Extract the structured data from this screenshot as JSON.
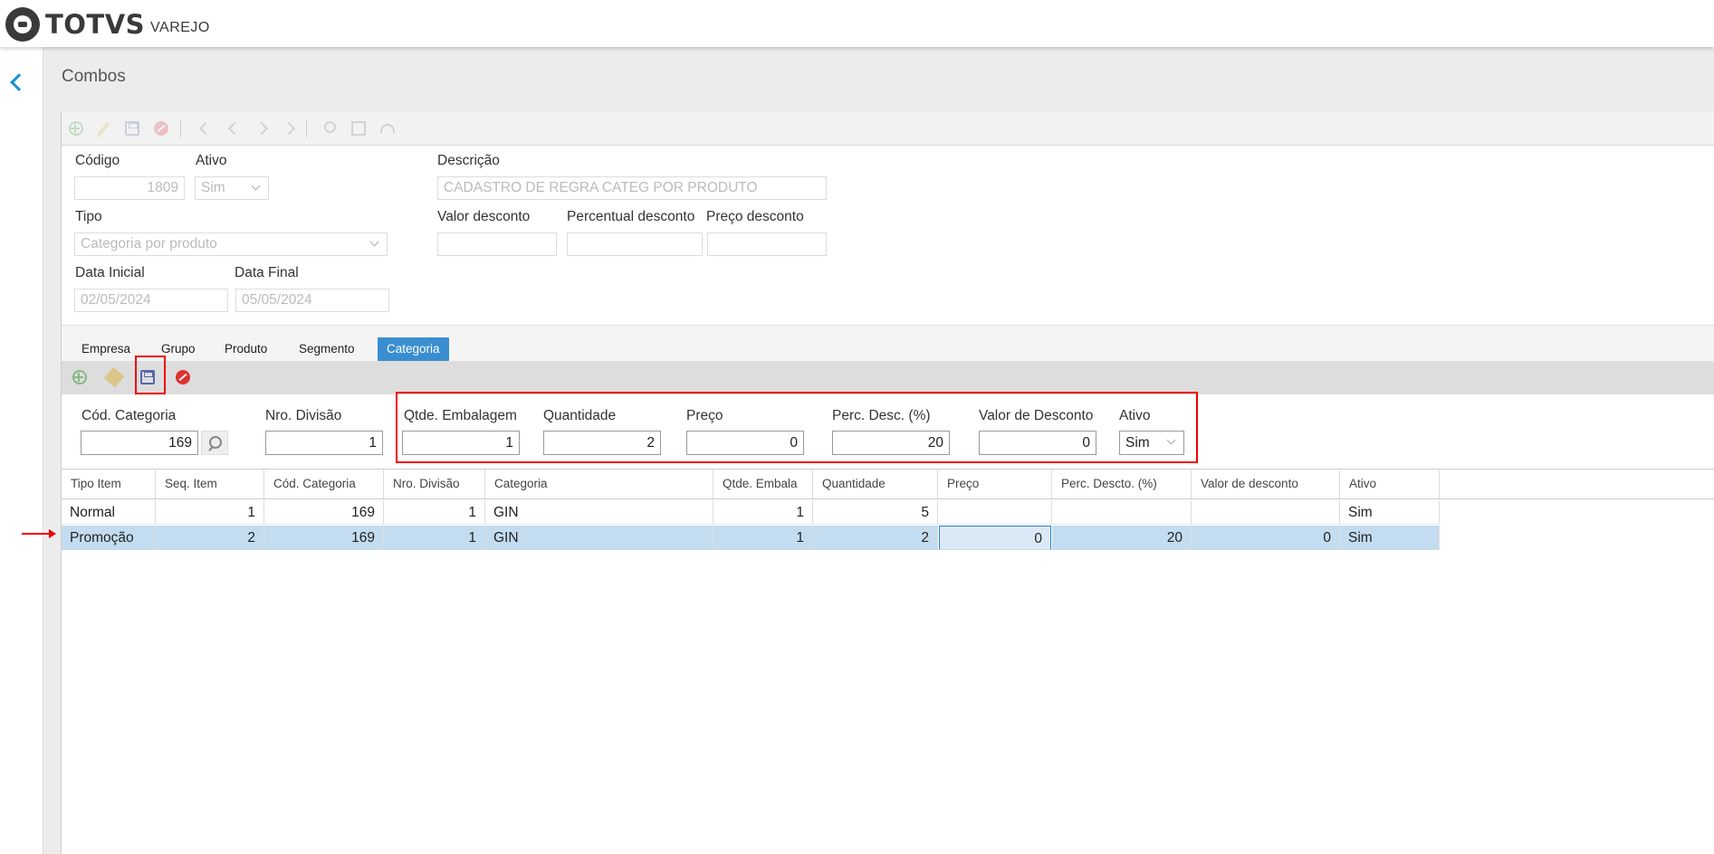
{
  "brand": {
    "name": "TOTVS",
    "sub": "VAREJO"
  },
  "page": {
    "title": "Combos"
  },
  "form": {
    "codigo": {
      "label": "Código",
      "value": "1809"
    },
    "ativo": {
      "label": "Ativo",
      "value": "Sim"
    },
    "descricao": {
      "label": "Descrição",
      "value": "CADASTRO DE REGRA CATEG POR PRODUTO"
    },
    "tipo": {
      "label": "Tipo",
      "value": "Categoria por produto"
    },
    "valor_desconto": {
      "label": "Valor desconto",
      "value": ""
    },
    "percentual_desconto": {
      "label": "Percentual desconto",
      "value": ""
    },
    "preco_desconto": {
      "label": "Preço desconto",
      "value": ""
    },
    "data_inicial": {
      "label": "Data Inicial",
      "value": "02/05/2024"
    },
    "data_final": {
      "label": "Data Final",
      "value": "05/05/2024"
    }
  },
  "tabs": [
    "Empresa",
    "Grupo",
    "Produto",
    "Segmento",
    "Categoria"
  ],
  "active_tab": "Categoria",
  "detail": {
    "cod_categoria": {
      "label": "Cód. Categoria",
      "value": "169"
    },
    "nro_divisao": {
      "label": "Nro. Divisão",
      "value": "1"
    },
    "qtde_embalagem": {
      "label": "Qtde. Embalagem",
      "value": "1"
    },
    "quantidade": {
      "label": "Quantidade",
      "value": "2"
    },
    "preco": {
      "label": "Preço",
      "value": "0"
    },
    "perc_desc": {
      "label": "Perc. Desc. (%)",
      "value": "20"
    },
    "valor_de_desconto": {
      "label": "Valor de Desconto",
      "value": "0"
    },
    "ativo": {
      "label": "Ativo",
      "value": "Sim"
    }
  },
  "grid": {
    "columns": [
      "Tipo Item",
      "Seq. Item",
      "Cód. Categoria",
      "Nro. Divisão",
      "Categoria",
      "Qtde. Embala",
      "Quantidade",
      "Preço",
      "Perc. Descto. (%)",
      "Valor de desconto",
      "Ativo"
    ],
    "rows": [
      [
        "Normal",
        "1",
        "169",
        "1",
        "GIN",
        "1",
        "5",
        "",
        "",
        "",
        "Sim"
      ],
      [
        "Promoção",
        "2",
        "169",
        "1",
        "GIN",
        "1",
        "2",
        "0",
        "20",
        "0",
        "Sim"
      ]
    ]
  },
  "colors": {
    "accent": "#3a8ed0",
    "highlight_box": "#ee0000",
    "selected_row": "#c3dcf0"
  }
}
